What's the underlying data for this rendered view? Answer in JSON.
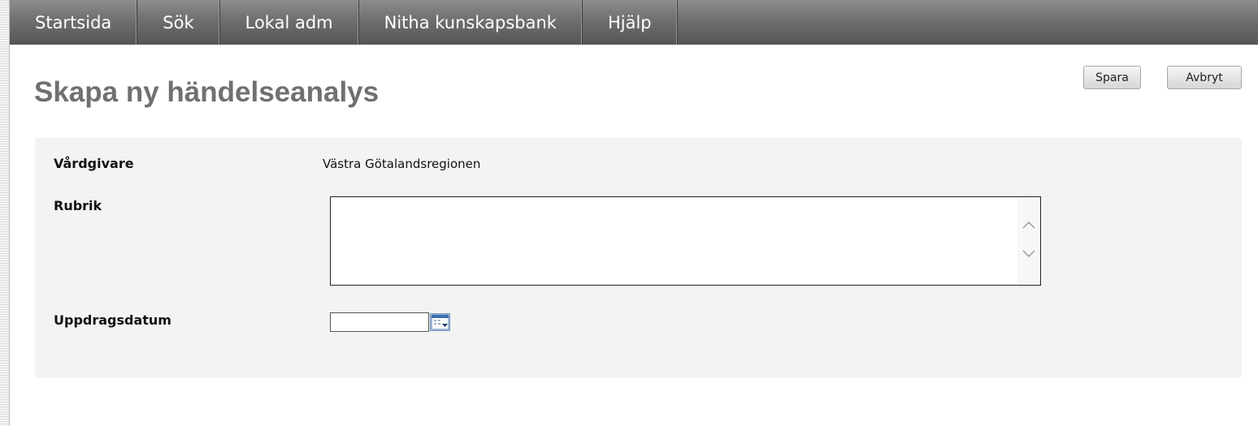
{
  "nav": {
    "items": [
      "Startsida",
      "Sök",
      "Lokal adm",
      "Nitha kunskapsbank",
      "Hjälp"
    ]
  },
  "page": {
    "title": "Skapa ny händelseanalys"
  },
  "actions": {
    "save_label": "Spara",
    "cancel_label": "Avbryt"
  },
  "form": {
    "vardgivare_label": "Vårdgivare",
    "vardgivare_value": "Västra Götalandsregionen",
    "rubrik_label": "Rubrik",
    "rubrik_value": "",
    "uppdragsdatum_label": "Uppdragsdatum",
    "uppdragsdatum_value": ""
  },
  "icons": {
    "scroll_up": "chevron-up-icon",
    "scroll_down": "chevron-down-icon",
    "calendar": "calendar-icon"
  },
  "colors": {
    "nav_bg": "#6f6f6f",
    "title": "#707070",
    "panel_bg": "#f3f3f3",
    "calendar_accent": "#3d6fb0"
  }
}
